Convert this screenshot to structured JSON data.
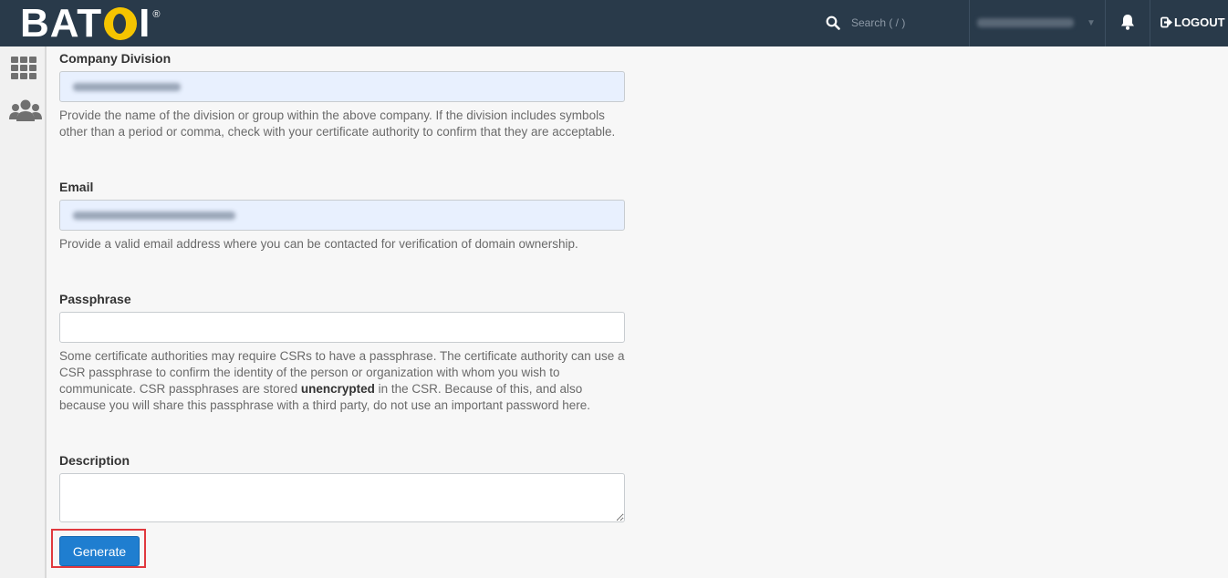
{
  "header": {
    "logo_text": "BAT",
    "logo_text_end": "I",
    "logo_registered": "®",
    "search_placeholder": "Search ( / )",
    "logout_label": "LOGOUT"
  },
  "colors": {
    "topbar": "#293a4a",
    "primary_button": "#1f7ed0",
    "highlight": "#e0393e"
  },
  "form": {
    "company_division": {
      "label": "Company Division",
      "help": "Provide the name of the division or group within the above company. If the division includes symbols other than a period or comma, check with your certificate authority to confirm that they are acceptable."
    },
    "email": {
      "label": "Email",
      "help": "Provide a valid email address where you can be contacted for verification of domain ownership."
    },
    "passphrase": {
      "label": "Passphrase",
      "value": "",
      "help_before": "Some certificate authorities may require CSRs to have a passphrase. The certificate authority can use a CSR passphrase to confirm the identity of the person or organization with whom you wish to communicate. CSR passphrases are stored ",
      "help_bold": "unencrypted",
      "help_after": " in the CSR. Because of this, and also because you will share this passphrase with a third party, do not use an important password here."
    },
    "description": {
      "label": "Description",
      "value": ""
    },
    "generate_label": "Generate"
  },
  "rail": {
    "icons": [
      "apps-grid-icon",
      "users-icon"
    ]
  }
}
